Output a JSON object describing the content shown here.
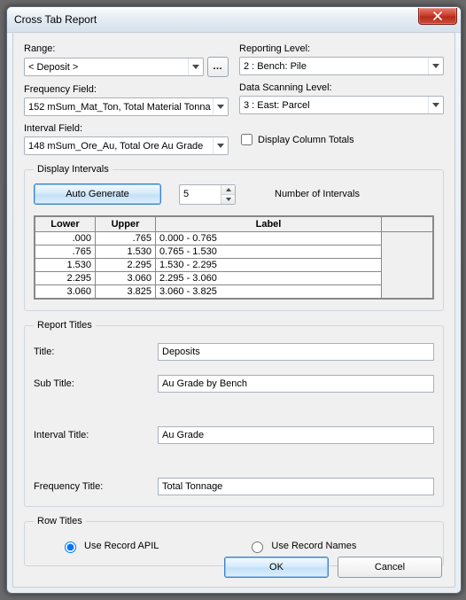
{
  "window": {
    "title": "Cross Tab Report"
  },
  "left": {
    "range": {
      "label": "Range:",
      "value": "< Deposit >"
    },
    "frequency_field": {
      "label": "Frequency Field:",
      "value": "152 mSum_Mat_Ton, Total Material Tonna"
    },
    "interval_field": {
      "label": "Interval Field:",
      "value": "148 mSum_Ore_Au, Total Ore Au Grade"
    }
  },
  "right": {
    "reporting_level": {
      "label": "Reporting Level:",
      "value": "2 : Bench: Pile"
    },
    "data_scanning_level": {
      "label": "Data Scanning Level:",
      "value": "3 : East: Parcel"
    },
    "display_column_totals": {
      "label": "Display Column Totals",
      "checked": false
    }
  },
  "intervals": {
    "legend": "Display Intervals",
    "auto_generate": "Auto Generate",
    "count_value": "5",
    "count_label": "Number of Intervals",
    "headers": [
      "Lower",
      "Upper",
      "Label"
    ],
    "rows": [
      {
        "lower": ".000",
        "upper": ".765",
        "label": "0.000 - 0.765"
      },
      {
        "lower": ".765",
        "upper": "1.530",
        "label": "0.765 - 1.530"
      },
      {
        "lower": "1.530",
        "upper": "2.295",
        "label": "1.530 - 2.295"
      },
      {
        "lower": "2.295",
        "upper": "3.060",
        "label": "2.295 - 3.060"
      },
      {
        "lower": "3.060",
        "upper": "3.825",
        "label": "3.060 - 3.825"
      }
    ]
  },
  "report_titles": {
    "legend": "Report Titles",
    "title": {
      "label": "Title:",
      "value": "Deposits"
    },
    "sub_title": {
      "label": "Sub Title:",
      "value": "Au Grade by Bench"
    },
    "interval_title": {
      "label": "Interval Title:",
      "value": "Au Grade"
    },
    "frequency_title": {
      "label": "Frequency Title:",
      "value": "Total Tonnage"
    }
  },
  "row_titles": {
    "legend": "Row Titles",
    "option_apil": "Use Record APIL",
    "option_names": "Use Record Names",
    "selected": "apil"
  },
  "footer": {
    "ok": "OK",
    "cancel": "Cancel"
  }
}
